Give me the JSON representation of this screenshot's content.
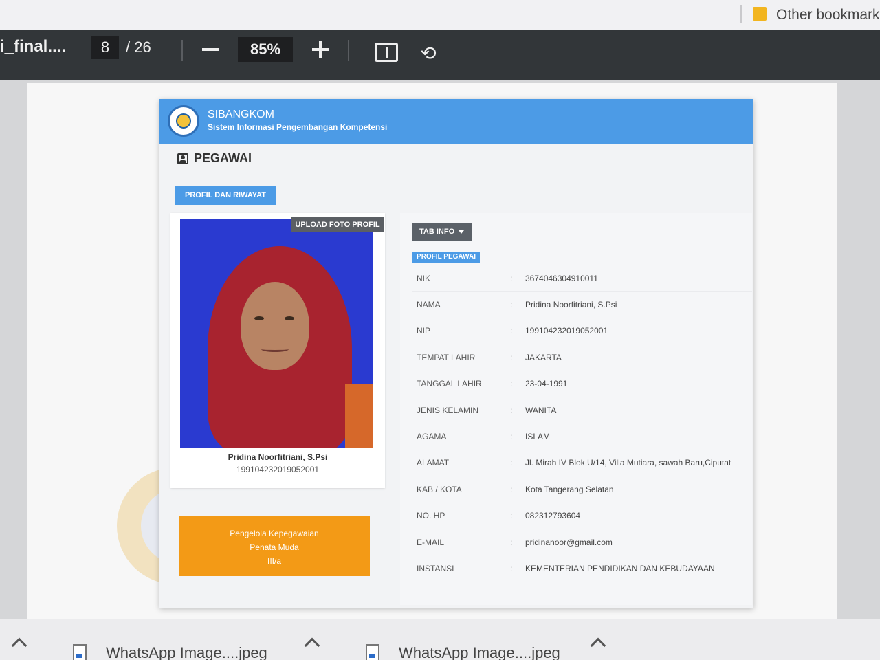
{
  "bookmarks": {
    "other_label": "Other bookmarks"
  },
  "toolbar": {
    "doc_title": "i_final....",
    "page_current": "8",
    "page_total": "/ 26",
    "zoom": "85%"
  },
  "app": {
    "name": "SIBANGKOM",
    "subtitle": "Sistem Informasi Pengembangan Kompetensi",
    "section_title": "PEGAWAI",
    "profil_button": "PROFIL DAN RIWAYAT",
    "upload_button": "UPLOAD FOTO PROFIL",
    "profile_name": "Pridina Noorfitriani, S.Psi",
    "profile_nip": "199104232019052001",
    "role": {
      "line1": "Pengelola Kepegawaian",
      "line2": "Penata Muda",
      "line3": "III/a"
    },
    "tab_button": "TAB INFO",
    "badge": "PROFIL PEGAWAI",
    "rows": [
      {
        "label": "NIK",
        "value": "3674046304910011"
      },
      {
        "label": "NAMA",
        "value": "Pridina Noorfitriani, S.Psi"
      },
      {
        "label": "NIP",
        "value": "199104232019052001"
      },
      {
        "label": "TEMPAT LAHIR",
        "value": "JAKARTA"
      },
      {
        "label": "TANGGAL LAHIR",
        "value": "23-04-1991"
      },
      {
        "label": "JENIS KELAMIN",
        "value": "WANITA"
      },
      {
        "label": "AGAMA",
        "value": "ISLAM"
      },
      {
        "label": "ALAMAT",
        "value": "Jl. Mirah IV Blok U/14, Villa Mutiara, sawah Baru,Ciputat"
      },
      {
        "label": "KAB / KOTA",
        "value": "Kota Tangerang Selatan"
      },
      {
        "label": "NO. HP",
        "value": "082312793604"
      },
      {
        "label": "E-MAIL",
        "value": "pridinanoor@gmail.com"
      },
      {
        "label": "INSTANSI",
        "value": "KEMENTERIAN PENDIDIKAN DAN KEBUDAYAAN"
      }
    ]
  },
  "downloads": [
    {
      "label": "WhatsApp Image....jpeg"
    },
    {
      "label": "WhatsApp Image....jpeg"
    }
  ]
}
